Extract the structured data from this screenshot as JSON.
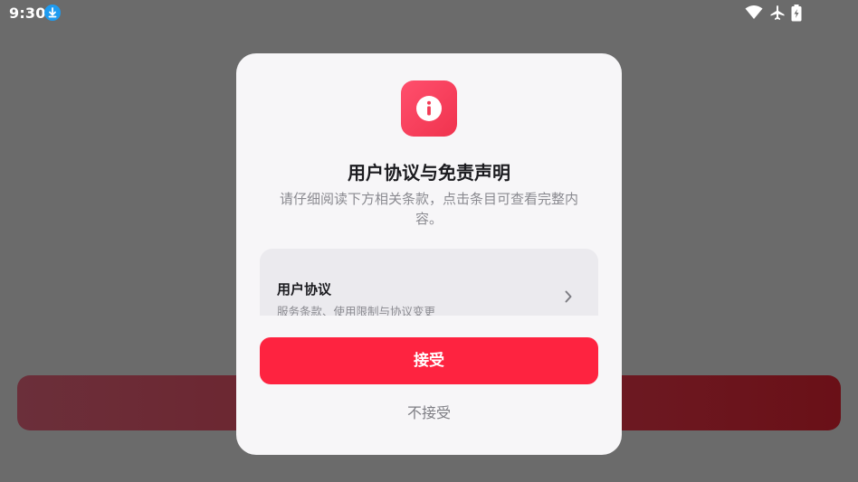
{
  "status_bar": {
    "time": "9:30",
    "icons": [
      "download-icon",
      "wifi-icon",
      "airplane-mode-icon",
      "battery-charging-icon"
    ]
  },
  "dialog": {
    "icon": "info-icon",
    "title": "用户协议与免责声明",
    "description": "请仔细阅读下方相关条款，点击条目可查看完整内容。",
    "items": [
      {
        "title": "用户协议",
        "subtitle": "服务条款、使用限制与协议变更",
        "icon": "chevron-right-icon"
      }
    ],
    "accept_label": "接受",
    "decline_label": "不接受"
  },
  "colors": {
    "accent": "#fe2340",
    "icon_gradient_start": "#ff4f6d",
    "overlay": "#6b6b6b"
  }
}
